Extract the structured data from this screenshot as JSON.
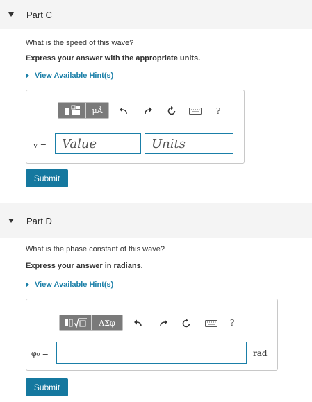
{
  "part_c": {
    "title": "Part C",
    "question": "What is the speed of this wave?",
    "instruction": "Express your answer with the appropriate units.",
    "hint_label": "View Available Hint(s)",
    "toolbar": {
      "templates_icon": "templates-icon",
      "units_label": "μÅ"
    },
    "variable_label": "v =",
    "value_placeholder": "Value",
    "units_placeholder": "Units",
    "help_label": "?",
    "submit_label": "Submit"
  },
  "part_d": {
    "title": "Part D",
    "question": "What is the phase constant of this wave?",
    "instruction": "Express your answer in radians.",
    "hint_label": "View Available Hint(s)",
    "toolbar": {
      "templates_icon": "templates-sqrt-icon",
      "symbols_label": "ΑΣφ"
    },
    "variable_label": "φ₀ =",
    "answer_value": "",
    "unit": "rad",
    "help_label": "?",
    "submit_label": "Submit"
  },
  "colors": {
    "accent": "#1a7fa8",
    "submit_bg": "#15789f",
    "header_bg": "#f4f4f4",
    "toolbar_btn": "#7a7a7a"
  }
}
